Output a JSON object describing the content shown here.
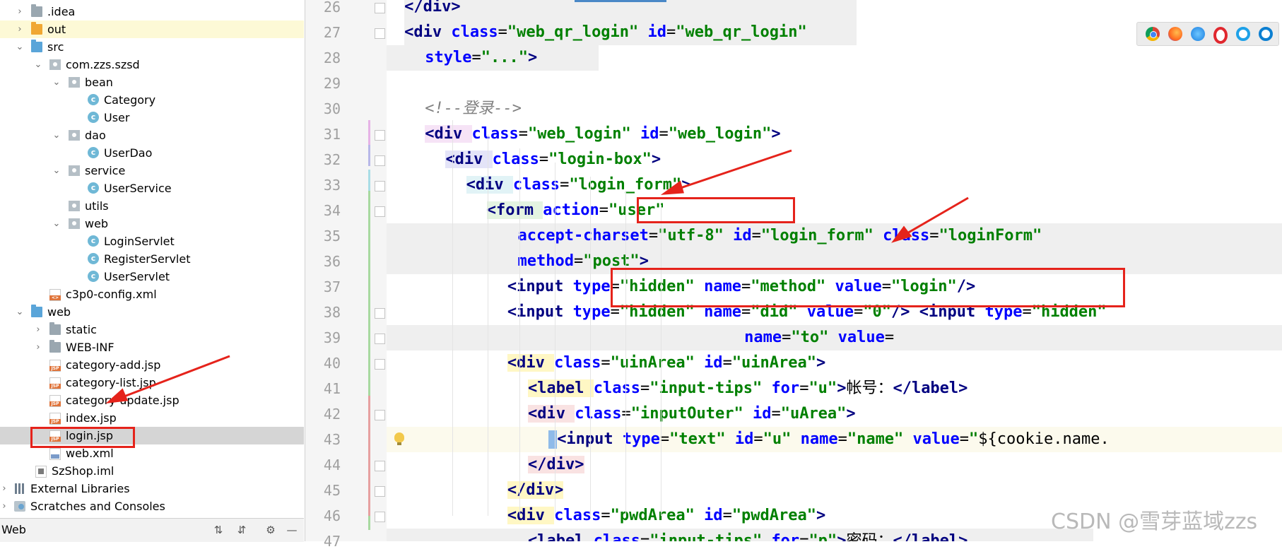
{
  "project_tree": {
    "rows": [
      {
        "label": ".idea",
        "icon": "folder-icon",
        "arrow": "›"
      },
      {
        "label": "out",
        "icon": "folder-orange-icon",
        "arrow": "›"
      },
      {
        "label": "src",
        "icon": "folder-blue-icon",
        "arrow": "⌄"
      },
      {
        "label": "com.zzs.szsd",
        "icon": "package-icon",
        "arrow": "⌄"
      },
      {
        "label": "bean",
        "icon": "package-icon",
        "arrow": "⌄"
      },
      {
        "label": "Category",
        "icon": "class-icon",
        "arrow": ""
      },
      {
        "label": "User",
        "icon": "class-icon",
        "arrow": ""
      },
      {
        "label": "dao",
        "icon": "package-icon",
        "arrow": "⌄"
      },
      {
        "label": "UserDao",
        "icon": "class-icon",
        "arrow": ""
      },
      {
        "label": "service",
        "icon": "package-icon",
        "arrow": "⌄"
      },
      {
        "label": "UserService",
        "icon": "class-icon",
        "arrow": ""
      },
      {
        "label": "utils",
        "icon": "package-icon",
        "arrow": ""
      },
      {
        "label": "web",
        "icon": "package-icon",
        "arrow": "⌄"
      },
      {
        "label": "LoginServlet",
        "icon": "class-icon",
        "arrow": ""
      },
      {
        "label": "RegisterServlet",
        "icon": "class-icon",
        "arrow": ""
      },
      {
        "label": "UserServlet",
        "icon": "class-icon",
        "arrow": ""
      },
      {
        "label": "c3p0-config.xml",
        "icon": "xml-file-icon",
        "arrow": ""
      },
      {
        "label": "web",
        "icon": "web-folder-icon",
        "arrow": "⌄"
      },
      {
        "label": "static",
        "icon": "folder-icon",
        "arrow": "›"
      },
      {
        "label": "WEB-INF",
        "icon": "folder-icon",
        "arrow": "›"
      },
      {
        "label": "category-add.jsp",
        "icon": "jsp-file-icon",
        "arrow": ""
      },
      {
        "label": "category-list.jsp",
        "icon": "jsp-file-icon",
        "arrow": ""
      },
      {
        "label": "category-update.jsp",
        "icon": "jsp-file-icon",
        "arrow": ""
      },
      {
        "label": "index.jsp",
        "icon": "jsp-file-icon",
        "arrow": ""
      },
      {
        "label": "login.jsp",
        "icon": "jsp-file-icon",
        "arrow": ""
      },
      {
        "label": "web.xml",
        "icon": "web-xml-icon",
        "arrow": ""
      },
      {
        "label": "SzShop.iml",
        "icon": "iml-file-icon",
        "arrow": ""
      },
      {
        "label": "External Libraries",
        "icon": "library-icon",
        "arrow": "›"
      },
      {
        "label": "Scratches and Consoles",
        "icon": "scratch-icon",
        "arrow": "›"
      }
    ],
    "status_label": "Web"
  },
  "editor": {
    "line_numbers": [
      "26",
      "27",
      "28",
      "29",
      "30",
      "31",
      "32",
      "33",
      "34",
      "35",
      "36",
      "37",
      "38",
      "39",
      "40",
      "41",
      "42",
      "43",
      "44",
      "45",
      "46",
      "47"
    ],
    "colors": {
      "tag": "#000080",
      "attr": "#0000ff",
      "value": "#008000",
      "comment": "#808080",
      "annotation": "#e5231b"
    }
  },
  "watermark": "CSDN @雪芽蓝域zzs"
}
